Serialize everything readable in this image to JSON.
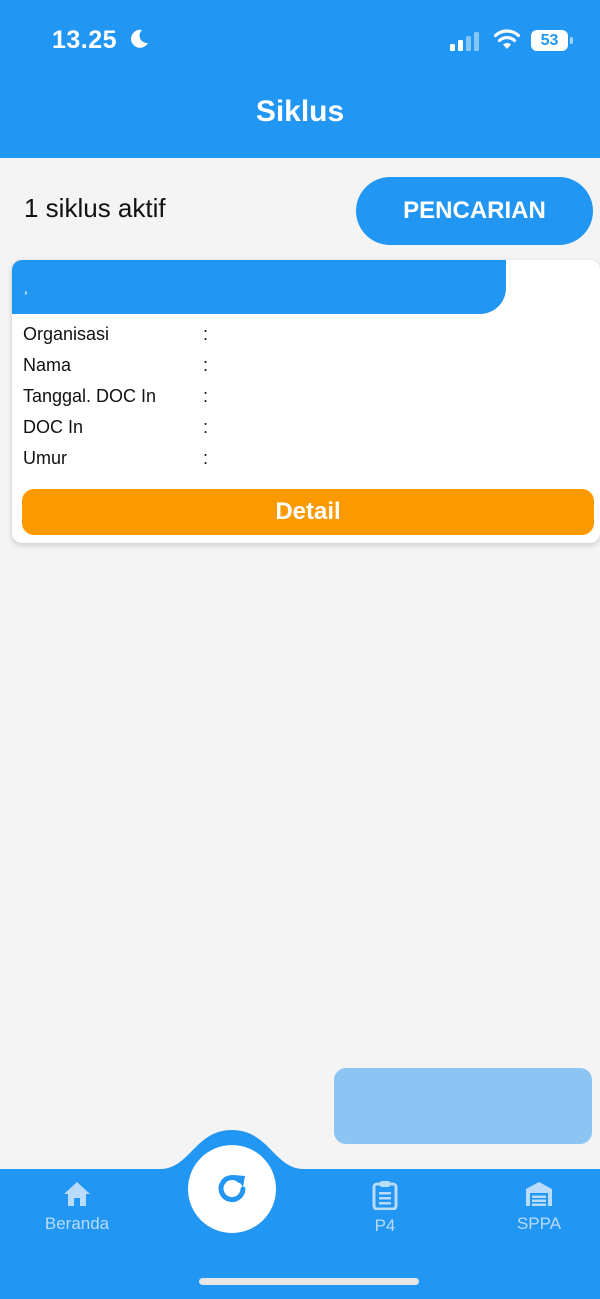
{
  "status_bar": {
    "time": "13.25",
    "battery": "53",
    "icons": [
      "moon-icon",
      "signal-icon",
      "wifi-icon",
      "battery-icon"
    ]
  },
  "header": {
    "title": "Siklus"
  },
  "summary": {
    "active_count_text": "1 siklus aktif",
    "search_label": "PENCARIAN"
  },
  "cycle_card": {
    "header_text": "‚",
    "fields": [
      {
        "label": "Organisasi",
        "colon": ":",
        "value": ""
      },
      {
        "label": "Nama",
        "colon": ":",
        "value": ""
      },
      {
        "label": "Tanggal. DOC In",
        "colon": ":",
        "value": ""
      },
      {
        "label": "DOC In",
        "colon": ":",
        "value": ""
      },
      {
        "label": "Umur",
        "colon": ":",
        "value": ""
      }
    ],
    "detail_label": "Detail"
  },
  "bottom_nav": {
    "items": [
      {
        "label": "Beranda",
        "icon": "home-icon"
      },
      {
        "label": "P4",
        "icon": "clipboard-icon"
      },
      {
        "label": "SPPA",
        "icon": "warehouse-icon"
      }
    ],
    "center_icon": "refresh-icon"
  },
  "colors": {
    "primary": "#2196f3",
    "accent": "#fb9a00",
    "background": "#f4f4f4",
    "nav_label": "#b9dcfb"
  }
}
